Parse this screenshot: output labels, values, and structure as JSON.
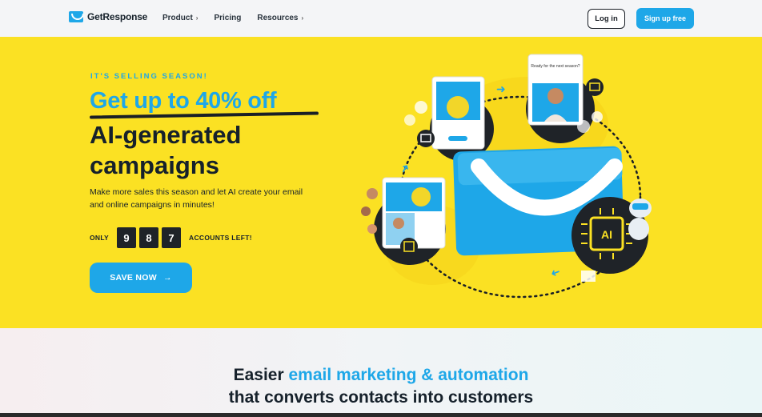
{
  "header": {
    "logo_text": "GetResponse",
    "nav": [
      {
        "label": "Product",
        "has_dropdown": true
      },
      {
        "label": "Pricing",
        "has_dropdown": false
      },
      {
        "label": "Resources",
        "has_dropdown": true
      }
    ],
    "login_label": "Log in",
    "signup_label": "Sign up free"
  },
  "hero": {
    "eyebrow": "IT'S SELLING SEASON!",
    "headline_highlight": "Get up to 40% off",
    "headline_line1": "AI-generated",
    "headline_line2": "campaigns",
    "subtext": "Make more sales this season and let AI create your email and online campaigns in minutes!",
    "counter_prefix": "ONLY",
    "counter_digits": [
      "9",
      "8",
      "7"
    ],
    "counter_suffix": "ACCOUNTS LEFT!",
    "cta_label": "SAVE NOW",
    "cta_icon": "arrow-right-icon",
    "illustration": {
      "card_top_text": "Ready for the next season?",
      "badge_text": "AI"
    }
  },
  "section": {
    "line1_dark": "Easier",
    "line1_blue": "email marketing & automation",
    "line2": "that converts contacts into customers"
  },
  "colors": {
    "brand_blue": "#1ea7e8",
    "hero_yellow": "#fbe123",
    "dark": "#16212b"
  }
}
